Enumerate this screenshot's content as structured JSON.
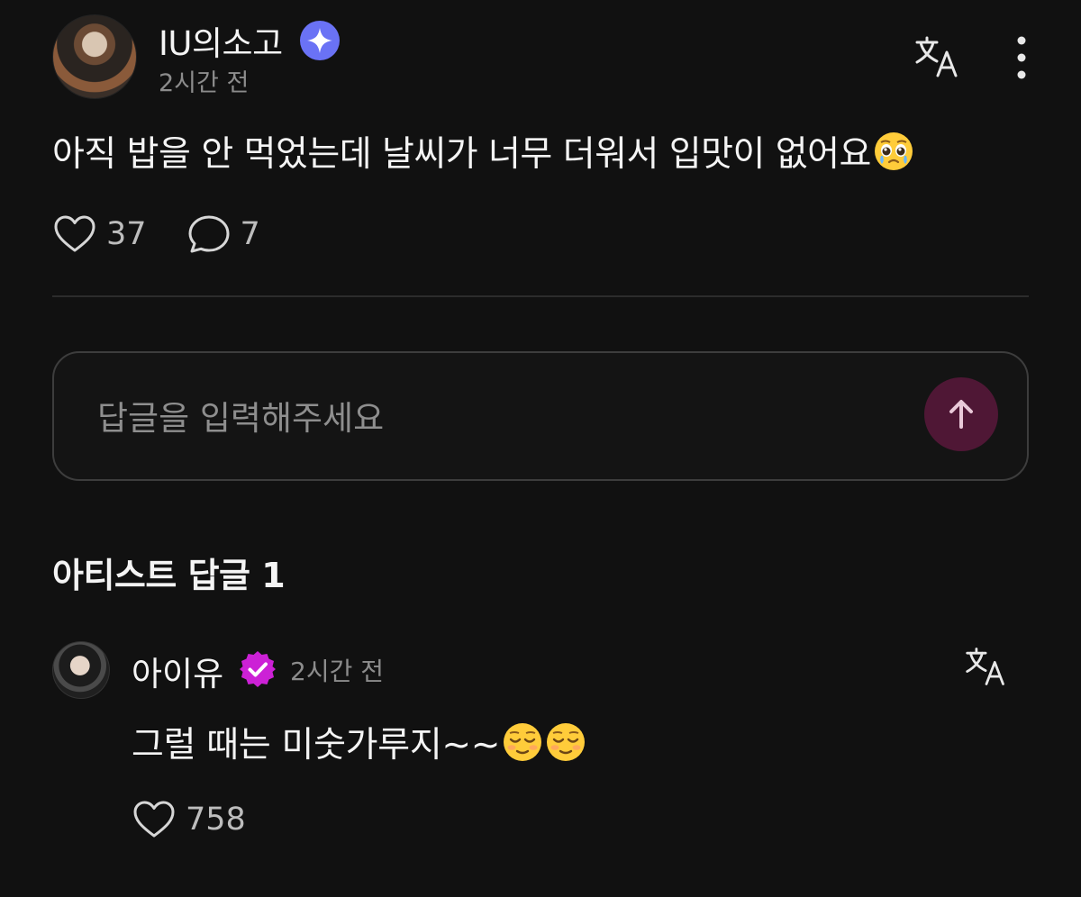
{
  "post": {
    "author": "IU의소고",
    "time": "2시간 전",
    "text": "아직 밥을 안 먹었는데 날씨가 너무 더워서 입맛이 없어요",
    "emoji": "pleading-face-with-tears",
    "likes": "37",
    "comments": "7"
  },
  "reply_input": {
    "placeholder": "답글을 입력해주세요"
  },
  "artist_replies": {
    "title": "아티스트 답글 1",
    "items": [
      {
        "author": "아이유",
        "time": "2시간 전",
        "text": "그럴 때는 미숫가루지~~",
        "emojis": [
          "relieved-face",
          "relieved-face"
        ],
        "likes": "758"
      }
    ]
  },
  "colors": {
    "background": "#111111",
    "verified_blue": "#6a72f5",
    "verified_purple": "#cc21d6",
    "send_button": "#4f1735"
  },
  "icons": [
    "translate-icon",
    "more-vertical-icon",
    "heart-icon",
    "comment-icon",
    "arrow-up-icon",
    "verified-badge-icon"
  ]
}
